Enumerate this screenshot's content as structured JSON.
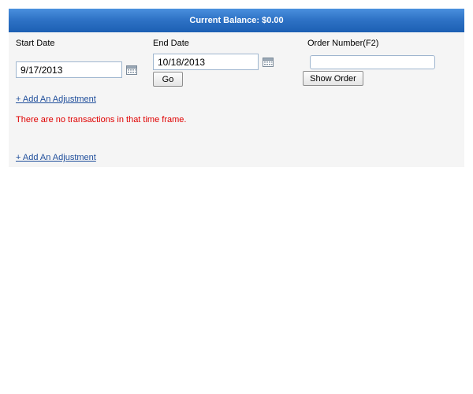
{
  "balance_bar": {
    "text": "Current Balance: $0.00"
  },
  "filters": {
    "start_date_label": "Start Date",
    "start_date_value": "9/17/2013",
    "end_date_label": "End Date",
    "end_date_value": "10/18/2013",
    "order_number_label": "Order Number(F2)",
    "order_number_value": "",
    "go_label": "Go",
    "show_order_label": "Show Order"
  },
  "links": {
    "add_adjustment_top": "+ Add An Adjustment",
    "add_adjustment_bottom": "+ Add An Adjustment"
  },
  "messages": {
    "no_transactions": "There are no transactions in that time frame."
  },
  "icons": {
    "start_calendar": "calendar-icon",
    "end_calendar": "calendar-icon"
  },
  "colors": {
    "header_blue": "#2f73c6",
    "panel_bg": "#f5f5f5",
    "link_blue": "#1f4e9b",
    "error_red": "#e00000"
  }
}
